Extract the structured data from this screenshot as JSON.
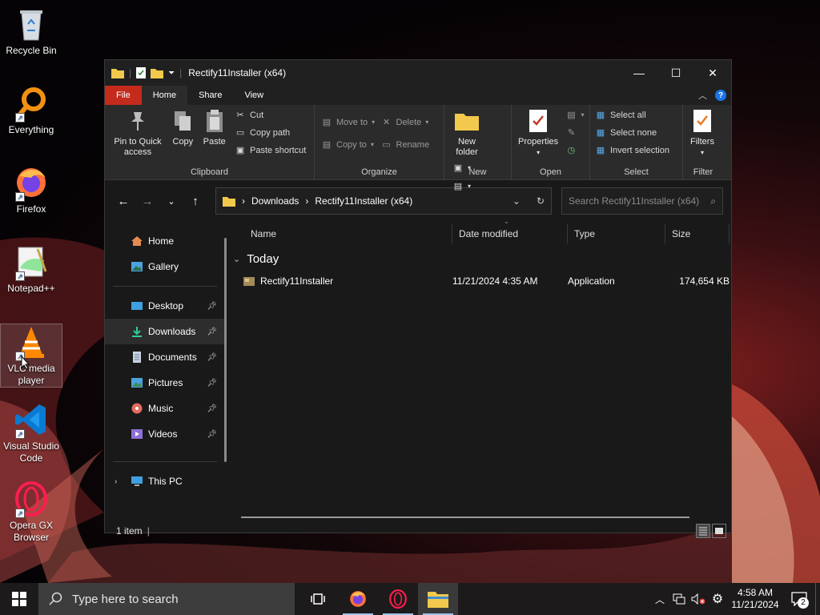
{
  "desktop": {
    "icons": [
      {
        "label": "Recycle Bin",
        "icon": "recycle-bin-icon"
      },
      {
        "label": "Everything",
        "icon": "everything-search-icon"
      },
      {
        "label": "Firefox",
        "icon": "firefox-icon"
      },
      {
        "label": "Notepad++",
        "icon": "notepad-plus-plus-icon"
      },
      {
        "label": "VLC media player",
        "icon": "vlc-icon"
      },
      {
        "label": "Visual Studio Code",
        "icon": "vscode-icon"
      },
      {
        "label": "Opera GX Browser",
        "icon": "opera-gx-icon"
      }
    ]
  },
  "window": {
    "title": "Rectify11Installer (x64)",
    "controls": {
      "minimize": "—",
      "maximize": "☐",
      "close": "✕"
    }
  },
  "ribbon": {
    "tabs": [
      "File",
      "Home",
      "Share",
      "View"
    ],
    "active_tab": "Home",
    "clipboard": {
      "pin": "Pin to Quick access",
      "copy": "Copy",
      "paste": "Paste",
      "cut": "Cut",
      "copy_path": "Copy path",
      "paste_shortcut": "Paste shortcut",
      "label": "Clipboard"
    },
    "organize": {
      "move_to": "Move to",
      "copy_to": "Copy to",
      "delete": "Delete",
      "rename": "Rename",
      "label": "Organize"
    },
    "new": {
      "new_folder": "New folder",
      "label": "New"
    },
    "open": {
      "properties": "Properties",
      "label": "Open"
    },
    "select": {
      "select_all": "Select all",
      "select_none": "Select none",
      "invert_selection": "Invert selection",
      "label": "Select"
    },
    "filter": {
      "filters": "Filters",
      "label": "Filter"
    }
  },
  "address": {
    "crumbs": [
      "Downloads",
      "Rectify11Installer (x64)"
    ],
    "search_placeholder": "Search Rectify11Installer (x64)"
  },
  "nav": {
    "items": [
      {
        "label": "Home",
        "icon": "home-icon",
        "pinned": false
      },
      {
        "label": "Gallery",
        "icon": "gallery-icon",
        "pinned": false
      },
      {
        "label": "Desktop",
        "icon": "desktop-folder-icon",
        "pinned": true
      },
      {
        "label": "Downloads",
        "icon": "downloads-folder-icon",
        "pinned": true
      },
      {
        "label": "Documents",
        "icon": "documents-folder-icon",
        "pinned": true
      },
      {
        "label": "Pictures",
        "icon": "pictures-folder-icon",
        "pinned": true
      },
      {
        "label": "Music",
        "icon": "music-folder-icon",
        "pinned": true
      },
      {
        "label": "Videos",
        "icon": "videos-folder-icon",
        "pinned": true
      },
      {
        "label": "This PC",
        "icon": "this-pc-icon",
        "pinned": false
      }
    ],
    "selected": "Downloads"
  },
  "files": {
    "columns": [
      "Name",
      "Date modified",
      "Type",
      "Size"
    ],
    "group": "Today",
    "rows": [
      {
        "name": "Rectify11Installer",
        "date": "11/21/2024 4:35 AM",
        "type": "Application",
        "size": "174,654 KB"
      }
    ]
  },
  "status": {
    "count": "1 item"
  },
  "taskbar": {
    "search_placeholder": "Type here to search",
    "time": "4:58 AM",
    "date": "11/21/2024",
    "notification_count": "2"
  },
  "colors": {
    "file_tab": "#c42b1c",
    "accent": "#1a73e8",
    "window_bg": "#191919",
    "ribbon_bg": "#2b2b2b"
  }
}
